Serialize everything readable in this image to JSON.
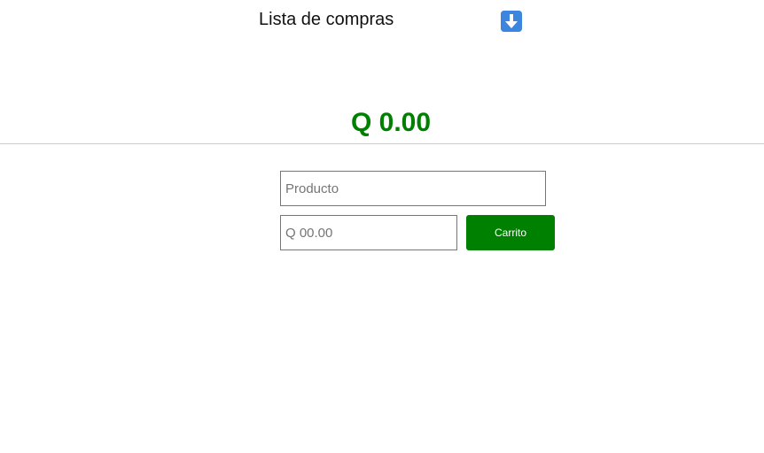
{
  "header": {
    "title": "Lista de compras",
    "toggle_icon": "down-arrow-icon"
  },
  "summary": {
    "total": "Q 0.00"
  },
  "form": {
    "product_placeholder": "Producto",
    "price_placeholder": "Q 00.00",
    "cart_button_label": "Carrito"
  },
  "colors": {
    "accent": "#008000",
    "icon_bg": "#3d86e0"
  }
}
